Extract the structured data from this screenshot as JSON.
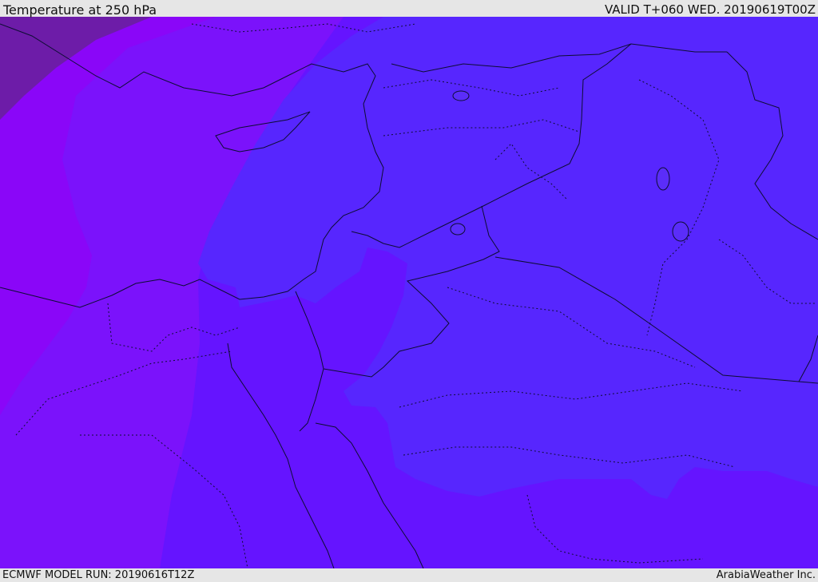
{
  "header": {
    "title": "Temperature at 250 hPa",
    "valid": "VALID T+060 WED. 20190619T00Z"
  },
  "footer": {
    "model_run": "ECMWF MODEL RUN: 20190616T12Z",
    "credit": "ArabiaWeather Inc."
  },
  "colors": {
    "darkest": "#6d1ca8",
    "violet": "#8a06f8",
    "purple": "#7b12fb",
    "indigo": "#6514ff",
    "blue": "#5726fe",
    "blue_light": "#5b2df9",
    "border": "#0d0d33"
  }
}
